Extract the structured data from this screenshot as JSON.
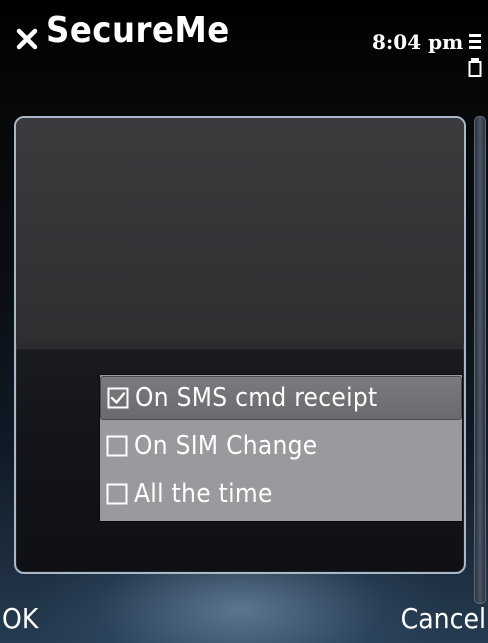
{
  "title_bar": {
    "app_title": "SecureMe",
    "clock": "8:04 pm"
  },
  "options": [
    {
      "label": "On SMS cmd receipt",
      "checked": true,
      "highlighted": true
    },
    {
      "label": "On SIM Change",
      "checked": false,
      "highlighted": false
    },
    {
      "label": "All the time",
      "checked": false,
      "highlighted": false
    }
  ],
  "softkeys": {
    "left": "OK",
    "right": "Cancel"
  },
  "icons": {
    "close": "close-icon",
    "signal": "signal-icon",
    "checkbox_checked": "checkbox-checked-icon",
    "checkbox_unchecked": "checkbox-unchecked-icon"
  }
}
